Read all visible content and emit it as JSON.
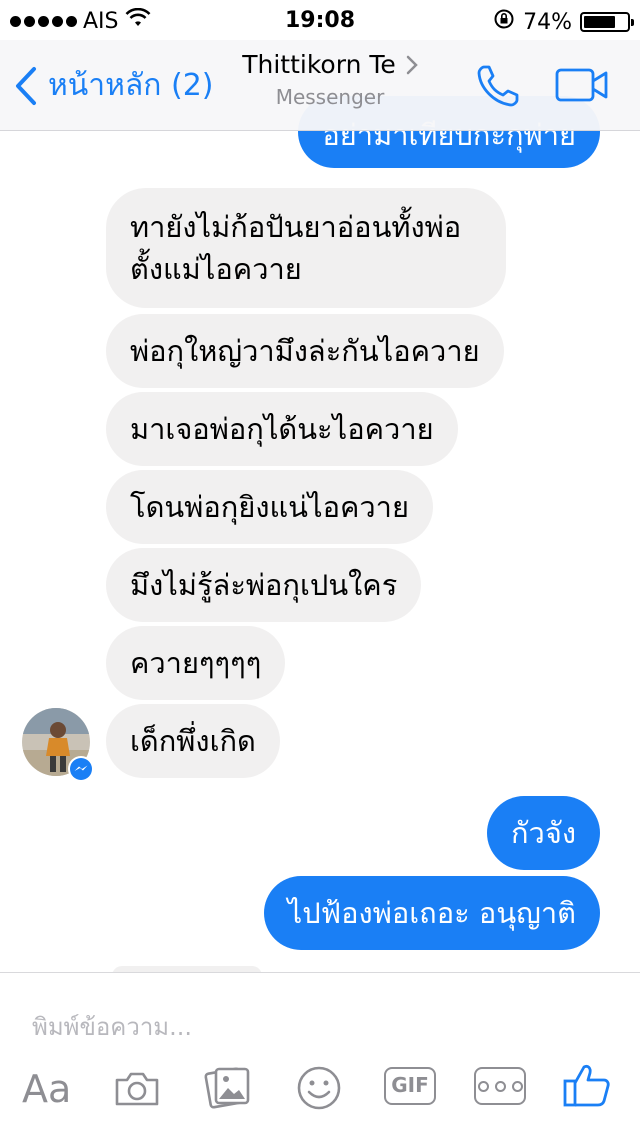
{
  "status": {
    "carrier": "AIS",
    "time": "19:08",
    "battery": "74%",
    "battery_level": 0.74
  },
  "nav": {
    "back_label": "หน้าหลัก (2)",
    "contact_name": "Thittikorn Te",
    "subtitle": "Messenger"
  },
  "messages": {
    "out_partial": "อย่ามาเทียบกะกุพ่าย",
    "in": [
      "ทายังไม่ก้อปันยาอ่อนทั้งพ่อ ตั้งแม่ไอควาย",
      "พ่อกุใหญ่วามึงล่ะกันไอควาย",
      "มาเจอพ่อกุได้นะไอควาย",
      "โดนพ่อกุยิงแน่ไอควาย",
      "มึงไม่รู้ล่ะพ่อกุเปนใคร",
      "ควายๆๆๆๆ",
      "เด็กพึ่งเกิด"
    ],
    "out": [
      "กัวจัง",
      "ไปฟ้องพ่อเถอะ อนุญาติ"
    ]
  },
  "composer": {
    "placeholder": "พิมพ์ข้อความ...",
    "aa_label": "Aa",
    "gif_label": "GIF"
  },
  "colors": {
    "accent": "#1a7ff5",
    "incoming_bubble": "#f1f0f0"
  },
  "icons": [
    "wifi-icon",
    "lock-rotation-icon",
    "phone-icon",
    "video-camera-icon",
    "camera-icon",
    "gallery-icon",
    "emoji-icon",
    "more-icon",
    "like-icon"
  ]
}
